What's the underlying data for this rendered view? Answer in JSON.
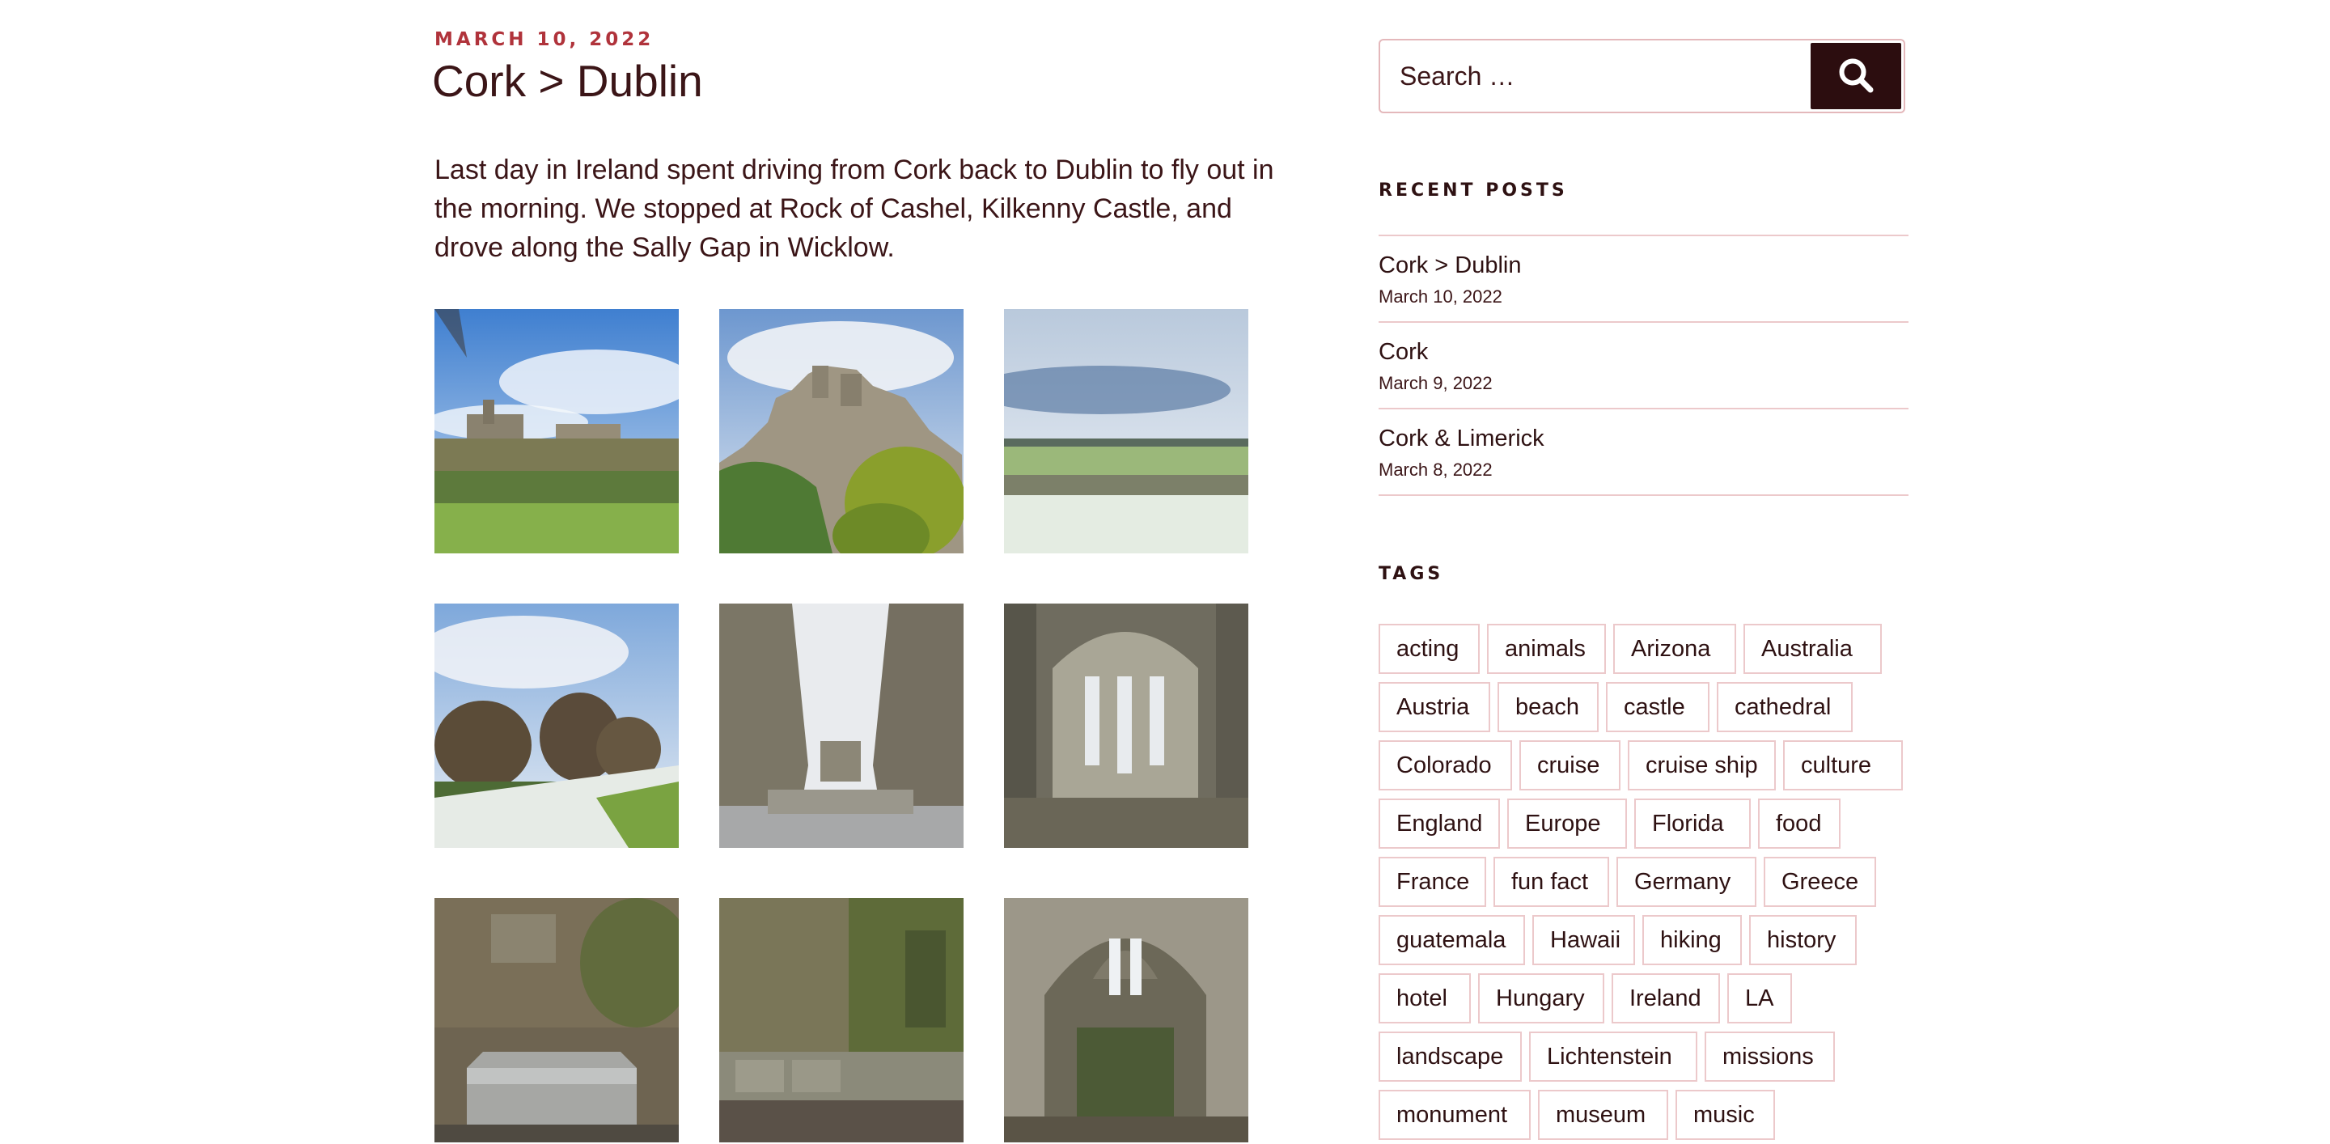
{
  "post": {
    "date": "March 10, 2022",
    "title": "Cork > Dublin",
    "body": "Last day in Ireland spent driving from Cork back to Dublin to fly out in the morning. We stopped at Rock of Cashel, Kilkenny Castle, and drove along the Sally Gap in Wicklow."
  },
  "search": {
    "placeholder": "Search …",
    "button_icon": "search-icon"
  },
  "recent_posts": {
    "title": "Recent Posts",
    "items": [
      {
        "title": "Cork > Dublin",
        "date": "March 10, 2022"
      },
      {
        "title": "Cork",
        "date": "March 9, 2022"
      },
      {
        "title": "Cork & Limerick",
        "date": "March 8, 2022"
      }
    ]
  },
  "tags": {
    "title": "Tags",
    "items": [
      "acting",
      "animals",
      "Arizona",
      "Australia",
      "Austria",
      "beach",
      "castle",
      "cathedral",
      "Colorado",
      "cruise",
      "cruise ship",
      "culture",
      "England",
      "Europe",
      "Florida",
      "food",
      "France",
      "fun fact",
      "Germany",
      "Greece",
      "guatemala",
      "Hawaii",
      "hiking",
      "history",
      "hotel",
      "Hungary",
      "Ireland",
      "LA",
      "landscape",
      "Lichtenstein",
      "missions",
      "monument",
      "museum",
      "music"
    ]
  },
  "colors": {
    "accent": "#b0333b",
    "text": "#2e1112",
    "button": "#2c0d0f",
    "border": "#ecc9cb"
  }
}
